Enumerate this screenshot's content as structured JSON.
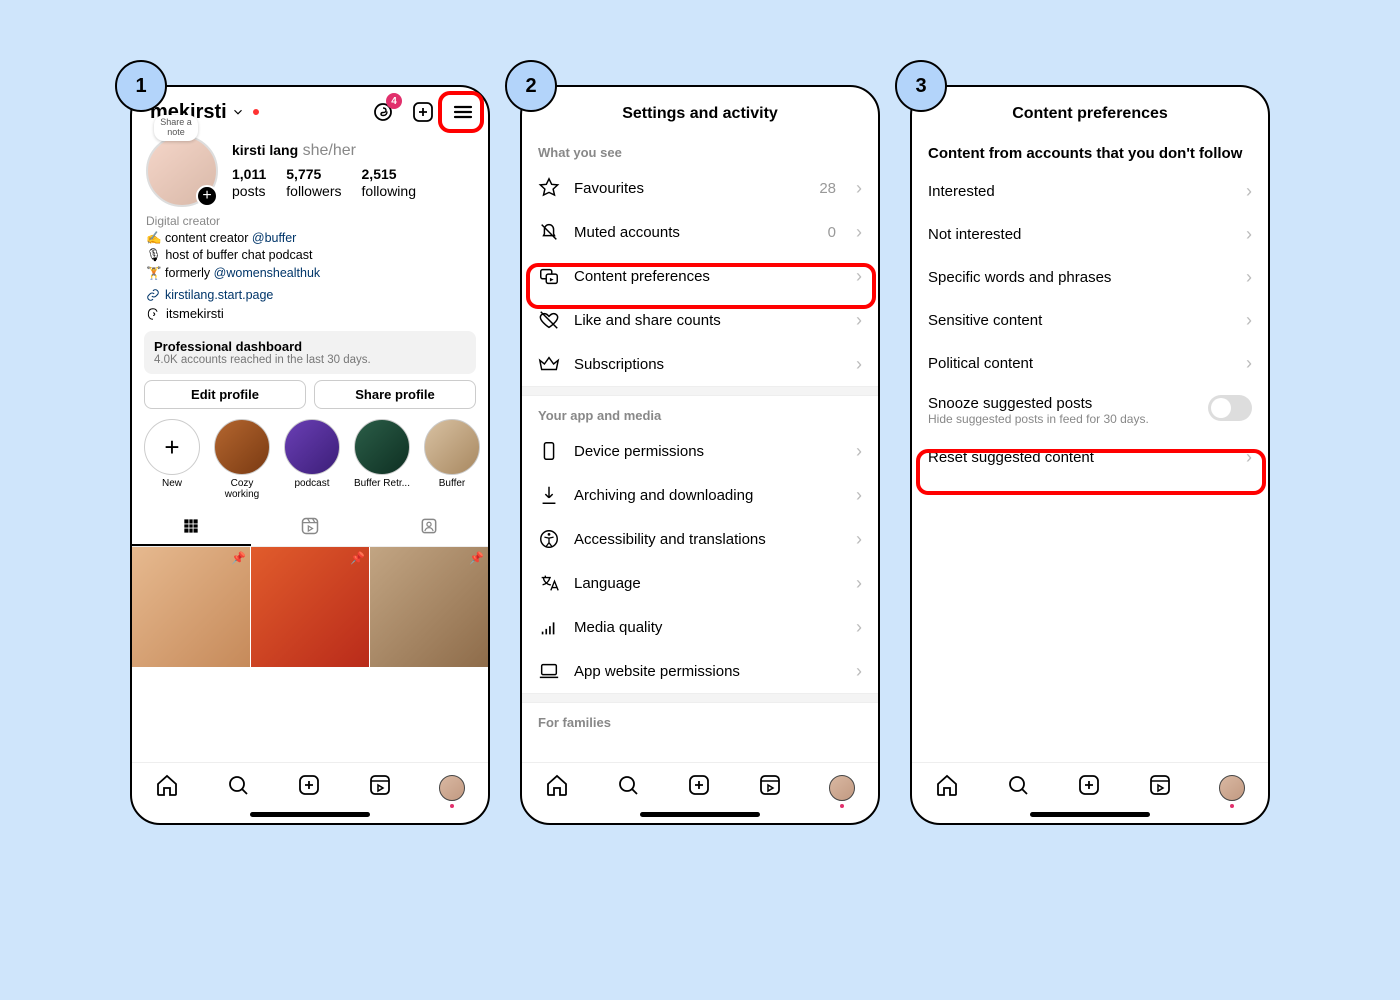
{
  "steps": [
    "1",
    "2",
    "3"
  ],
  "screen1": {
    "username": "mekirsti",
    "share_note": "Share a note",
    "notif_badge": "4",
    "display_name": "kirsti lang",
    "pronouns": "she/her",
    "stats": {
      "posts": "1,011",
      "posts_l": "posts",
      "followers": "5,775",
      "followers_l": "followers",
      "following": "2,515",
      "following_l": "following"
    },
    "bio_category": "Digital creator",
    "bio_line1_pre": "✍️ content creator ",
    "bio_line1_link": "@buffer",
    "bio_line2": "🎙 host of buffer chat podcast",
    "bio_line3_pre": "🏋️ formerly ",
    "bio_line3_link": "@womenshealthuk",
    "link": "kirstilang.start.page",
    "threads_handle": "itsmekirsti",
    "dash_title": "Professional dashboard",
    "dash_sub": "4.0K accounts reached in the last 30 days.",
    "edit_btn": "Edit profile",
    "share_btn": "Share profile",
    "highlights": [
      {
        "label": "New",
        "icon": "+"
      },
      {
        "label": "Cozy working"
      },
      {
        "label": "podcast"
      },
      {
        "label": "Buffer Retr..."
      },
      {
        "label": "Buffer"
      }
    ]
  },
  "screen2": {
    "title": "Settings and activity",
    "section1": "What you see",
    "items1": [
      {
        "label": "Favourites",
        "meta": "28"
      },
      {
        "label": "Muted accounts",
        "meta": "0"
      },
      {
        "label": "Content preferences",
        "highlight": true
      },
      {
        "label": "Like and share counts"
      },
      {
        "label": "Subscriptions"
      }
    ],
    "section2": "Your app and media",
    "items2": [
      {
        "label": "Device permissions"
      },
      {
        "label": "Archiving and downloading"
      },
      {
        "label": "Accessibility and translations"
      },
      {
        "label": "Language"
      },
      {
        "label": "Media quality"
      },
      {
        "label": "App website permissions"
      }
    ],
    "section3": "For families"
  },
  "screen3": {
    "title": "Content preferences",
    "header": "Content from accounts that you don't follow",
    "items": [
      {
        "label": "Interested"
      },
      {
        "label": "Not interested"
      },
      {
        "label": "Specific words and phrases"
      },
      {
        "label": "Sensitive content"
      },
      {
        "label": "Political content"
      }
    ],
    "snooze_title": "Snooze suggested posts",
    "snooze_desc": "Hide suggested posts in feed for 30 days.",
    "reset": "Reset suggested content"
  }
}
